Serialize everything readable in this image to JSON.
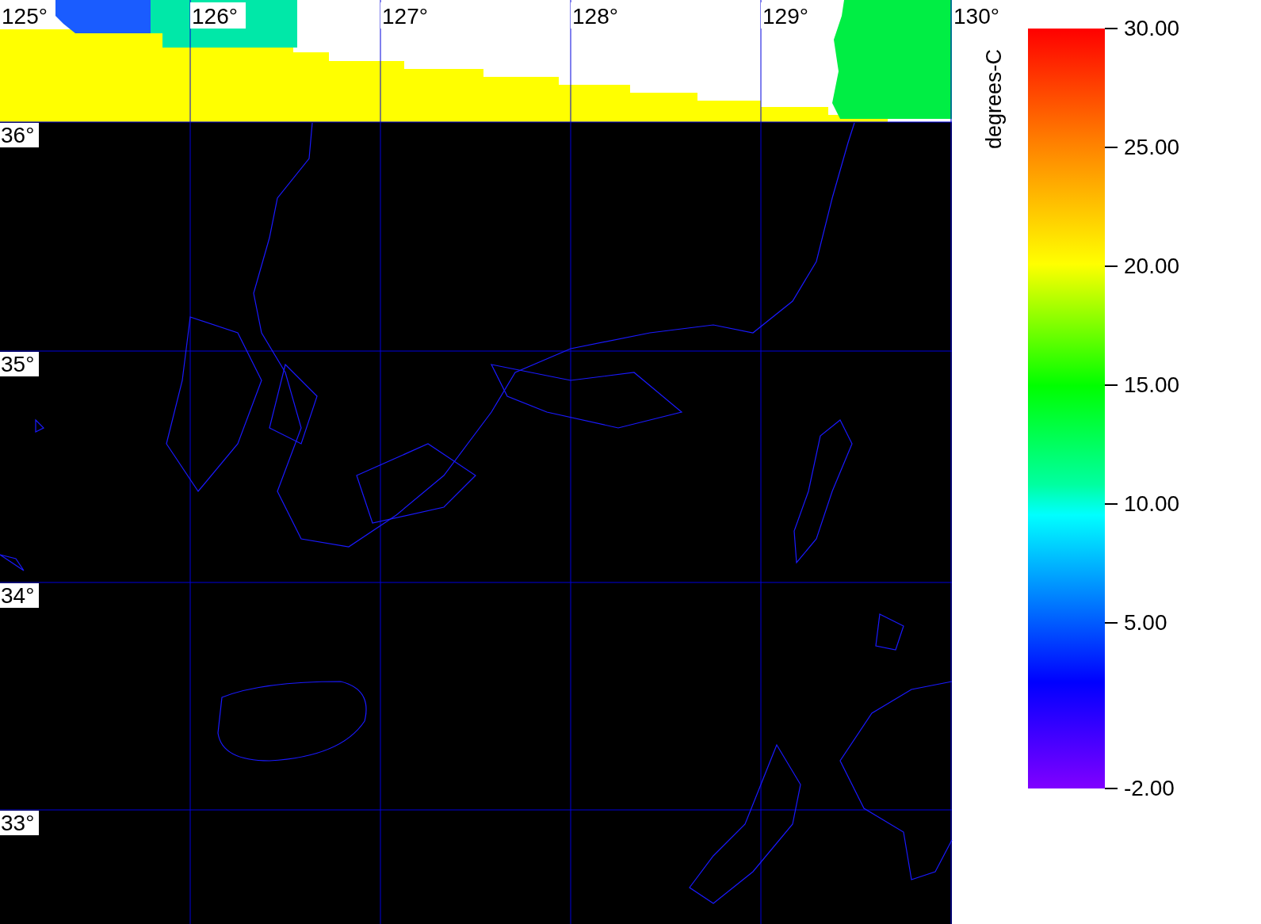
{
  "map": {
    "lon_labels": [
      "125°",
      "126°",
      "127°",
      "128°",
      "129°",
      "130°"
    ],
    "lat_labels": [
      "36°",
      "35°",
      "34°",
      "33°"
    ]
  },
  "colorbar": {
    "title": "degrees-C",
    "ticks": [
      "30.00",
      "25.00",
      "20.00",
      "15.00",
      "10.00",
      "5.00",
      "-2.00"
    ]
  }
}
